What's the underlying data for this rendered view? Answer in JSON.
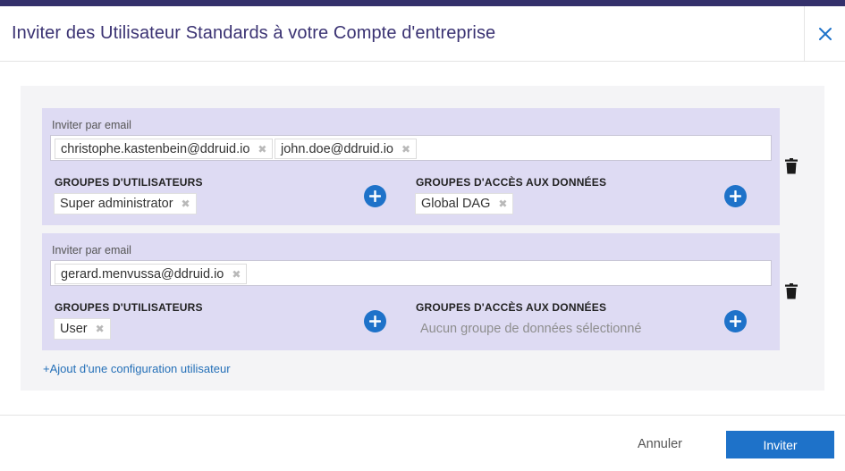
{
  "dialog": {
    "title": "Inviter des Utilisateur Standards à votre Compte d'entreprise",
    "close_icon": "close-icon",
    "accent_color": "#1e72c9",
    "title_color": "#3b3373"
  },
  "configurations": [
    {
      "email_label": "Inviter par email",
      "emails": [
        "christophe.kastenbein@ddruid.io",
        "john.doe@ddruid.io"
      ],
      "user_groups_label": "GROUPES D'UTILISATEURS",
      "user_groups": [
        "Super administrator"
      ],
      "data_groups_label": "GROUPES D'ACCÈS AUX DONNÉES",
      "data_groups": [
        "Global DAG"
      ],
      "data_groups_placeholder": ""
    },
    {
      "email_label": "Inviter par email",
      "emails": [
        "gerard.menvussa@ddruid.io"
      ],
      "user_groups_label": "GROUPES D'UTILISATEURS",
      "user_groups": [
        "User"
      ],
      "data_groups_label": "GROUPES D'ACCÈS AUX DONNÉES",
      "data_groups": [],
      "data_groups_placeholder": "Aucun groupe de données sélectionné"
    }
  ],
  "add_config_link": "+Ajout d'une configuration utilisateur",
  "footer": {
    "cancel_label": "Annuler",
    "invite_label": "Inviter"
  },
  "chip_remove_glyph": "✖"
}
